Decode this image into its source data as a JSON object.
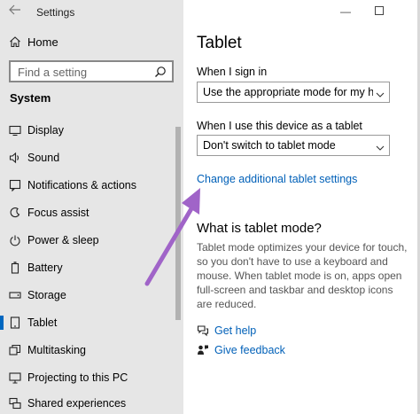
{
  "app": {
    "title": "Settings"
  },
  "window_controls": {
    "minimize": "—",
    "maximize": "☐"
  },
  "sidebar": {
    "home_label": "Home",
    "search_placeholder": "Find a setting",
    "section_label": "System",
    "items": [
      {
        "label": "Display",
        "icon": "display-icon"
      },
      {
        "label": "Sound",
        "icon": "sound-icon"
      },
      {
        "label": "Notifications & actions",
        "icon": "notifications-icon"
      },
      {
        "label": "Focus assist",
        "icon": "focus-assist-icon"
      },
      {
        "label": "Power & sleep",
        "icon": "power-icon"
      },
      {
        "label": "Battery",
        "icon": "battery-icon"
      },
      {
        "label": "Storage",
        "icon": "storage-icon"
      },
      {
        "label": "Tablet",
        "icon": "tablet-icon",
        "selected": true
      },
      {
        "label": "Multitasking",
        "icon": "multitasking-icon"
      },
      {
        "label": "Projecting to this PC",
        "icon": "projecting-icon"
      },
      {
        "label": "Shared experiences",
        "icon": "shared-experiences-icon"
      }
    ]
  },
  "main": {
    "title": "Tablet",
    "sign_in": {
      "label": "When I sign in",
      "value": "Use the appropriate mode for my hardw..."
    },
    "as_tablet": {
      "label": "When I use this device as a tablet",
      "value": "Don't switch to tablet mode"
    },
    "additional_link": "Change additional tablet settings",
    "what_is": {
      "heading": "What is tablet mode?",
      "description": "Tablet mode optimizes your device for touch, so you don't have to use a keyboard and mouse. When tablet mode is on, apps open full-screen and taskbar and desktop icons are reduced."
    },
    "get_help": "Get help",
    "give_feedback": "Give feedback"
  },
  "colors": {
    "accent": "#0067c0",
    "link": "#0060b8",
    "sidebar_bg": "#e6e6e6",
    "annotation_arrow": "#a064c8"
  }
}
